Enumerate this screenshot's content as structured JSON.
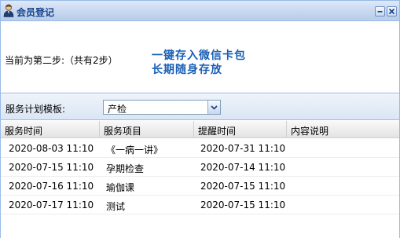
{
  "window": {
    "title": "会员登记"
  },
  "promo": {
    "step_text": "当前为第二步:（共有2步）",
    "slogan_line1": "一键存入微信卡包",
    "slogan_line2": "长期随身存放"
  },
  "toolbar": {
    "template_label": "服务计划模板:",
    "template_value": "产检"
  },
  "grid": {
    "columns": [
      "服务时间",
      "服务项目",
      "提醒时间",
      "内容说明"
    ],
    "rows": [
      [
        "2020-08-03 11:10",
        "《一病一讲》",
        "2020-07-31 11:10",
        ""
      ],
      [
        "2020-07-15 11:10",
        "孕期检查",
        "2020-07-14 11:10",
        ""
      ],
      [
        "2020-07-16 11:10",
        "瑜伽课",
        "2020-07-15 11:10",
        ""
      ],
      [
        "2020-07-17 11:10",
        "测试",
        "2020-07-15 11:10",
        ""
      ]
    ]
  },
  "colors": {
    "title_text": "#15428b",
    "slogan": "#1a5fb4",
    "border": "#99bbe8"
  },
  "icons": {
    "title": "user-icon",
    "minimize": "minimize-icon",
    "close": "close-icon",
    "dropdown": "chevron-down-icon"
  }
}
